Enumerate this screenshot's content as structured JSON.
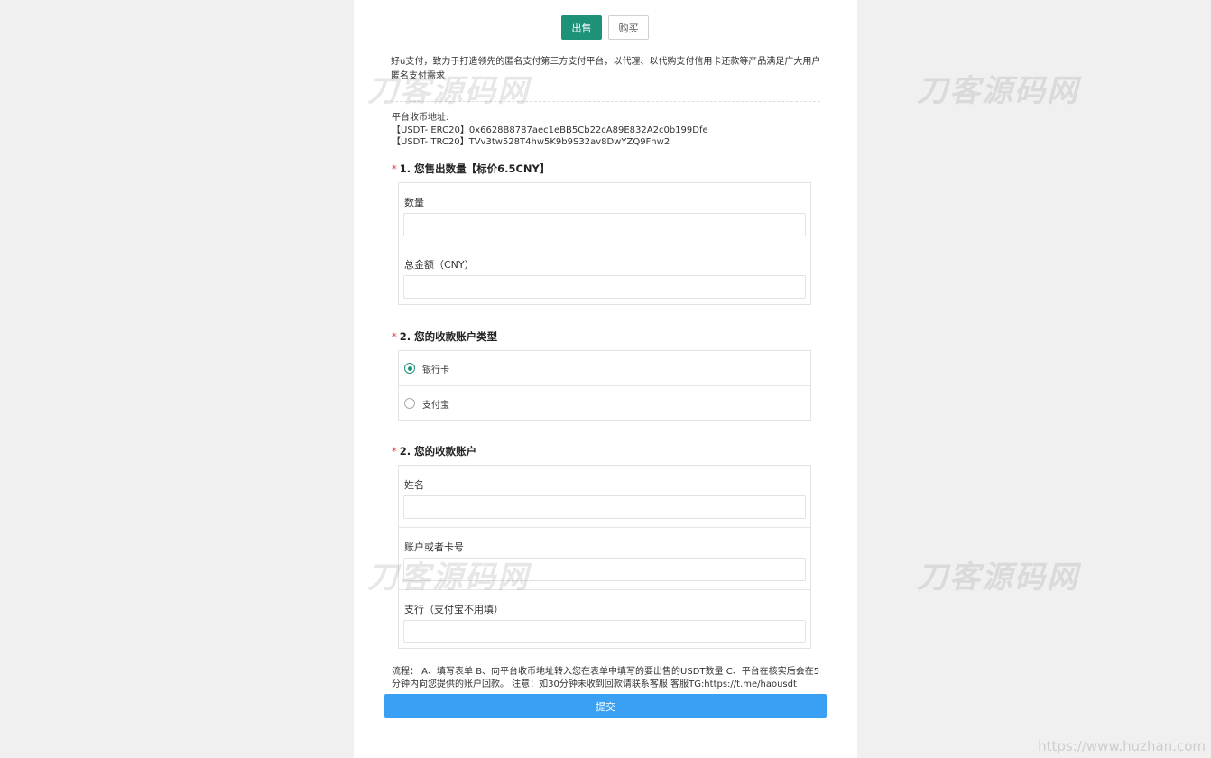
{
  "tabs": {
    "sell": "出售",
    "buy": "购买"
  },
  "intro": "好u支付，致力于打造领先的匿名支付第三方支付平台，以代理、以代购支付信用卡还款等产品满足广大用户匿名支付需求",
  "address": {
    "label": "平台收币地址:",
    "erc20": "【USDT- ERC20】0x6628B8787aec1eBB5Cb22cA89E832A2c0b199Dfe",
    "trc20": "【USDT- TRC20】TVv3tw528T4hw5K9b9S32av8DwYZQ9Fhw2"
  },
  "q1": {
    "title": "1. 您售出数量【标价6.5CNY】",
    "fields": [
      "数量",
      "总金额（CNY）"
    ]
  },
  "q2": {
    "title": "2. 您的收款账户类型",
    "options": [
      "银行卡",
      "支付宝"
    ],
    "selected": "银行卡"
  },
  "q3": {
    "title": "2. 您的收款账户",
    "fields": [
      "姓名",
      "账户或者卡号",
      "支行（支付宝不用填）"
    ]
  },
  "flow": "流程： A、填写表单 B、向平台收币地址转入您在表单中填写的要出售的USDT数量 C、平台在核实后会在5分钟内向您提供的账户回款。 注意：如30分钟未收到回款请联系客服 客服TG:https://t.me/haousdt",
  "submit": "提交",
  "watermark": "刀客源码网",
  "corner_url": "https://www.huzhan.com",
  "colors": {
    "accent": "#1e9278",
    "submit": "#3aa0f3",
    "required": "#e4393c"
  }
}
